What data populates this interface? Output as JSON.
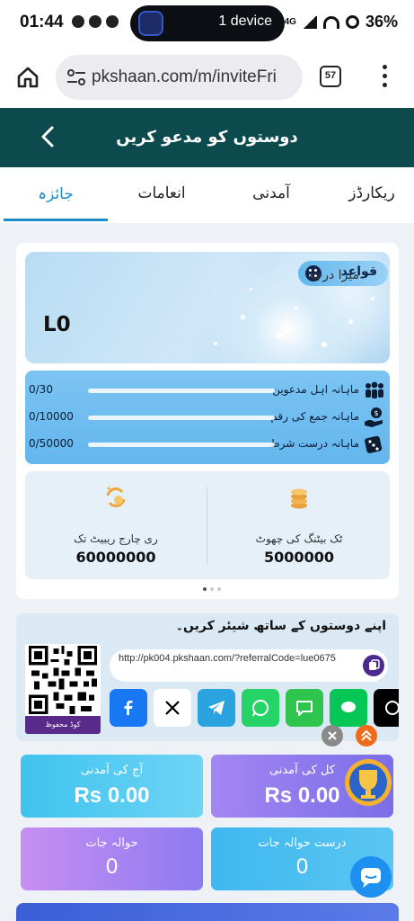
{
  "status_bar": {
    "time": "01:44",
    "device_pill": "1 device",
    "network": "4G",
    "battery": "36%"
  },
  "browser": {
    "url": "pkshaan.com/m/inviteFri",
    "tab_count": "57"
  },
  "header": {
    "title": "دوستوں کو مدعو کریں"
  },
  "tabs": [
    {
      "label": "ریکارڈز",
      "active": false
    },
    {
      "label": "آمدنی",
      "active": false
    },
    {
      "label": "انعامات",
      "active": false
    },
    {
      "label": "جائزہ",
      "active": true
    }
  ],
  "level": {
    "rules_label": "قواعد",
    "my_level_label": "میرا درجہ",
    "value": "L0"
  },
  "progress": [
    {
      "label": "ماہانہ اہل مدعوین",
      "value": "0/30",
      "fraction": 0,
      "icon": "people-icon"
    },
    {
      "label": "ماہانہ جمع کی رقم",
      "value": "0/10000",
      "fraction": 0,
      "icon": "money-hand-icon"
    },
    {
      "label": "ماہانہ درست شرط",
      "value": "0/50000",
      "fraction": 0,
      "icon": "dice-icon"
    }
  ],
  "rebates": [
    {
      "title": "ٹک بیٹنگ کی چھوٹ",
      "value": "5000000",
      "icon": "coins-icon"
    },
    {
      "title": "ری چارج ریبیٹ تک",
      "value": "60000000",
      "icon": "recharge-cycle-icon"
    }
  ],
  "share": {
    "title": "اپنے دوستوں کے ساتھ شیئر کریں۔",
    "qr_save_label": "کوڈ محفوظ",
    "referral_link": "http://pk004.pkshaan.com/?referralCode=lue0675",
    "socials": [
      "facebook-icon",
      "x-icon",
      "telegram-icon",
      "whatsapp-icon",
      "sms-icon",
      "line-icon",
      "threads-icon"
    ]
  },
  "stats": {
    "today_earnings_label": "آج کی آمدنی",
    "today_earnings_value": "Rs 0.00",
    "total_earnings_label": "کل کی آمدنی",
    "total_earnings_value": "Rs 0.00",
    "referrals_label": "حوالہ جات",
    "referrals_value": "0",
    "valid_referrals_label": "درست حوالہ جات",
    "valid_referrals_value": "0"
  },
  "colors": {
    "header_bg": "#0d4a4e",
    "accent": "#1e8cc8",
    "progress_fill": "#1877c9"
  }
}
